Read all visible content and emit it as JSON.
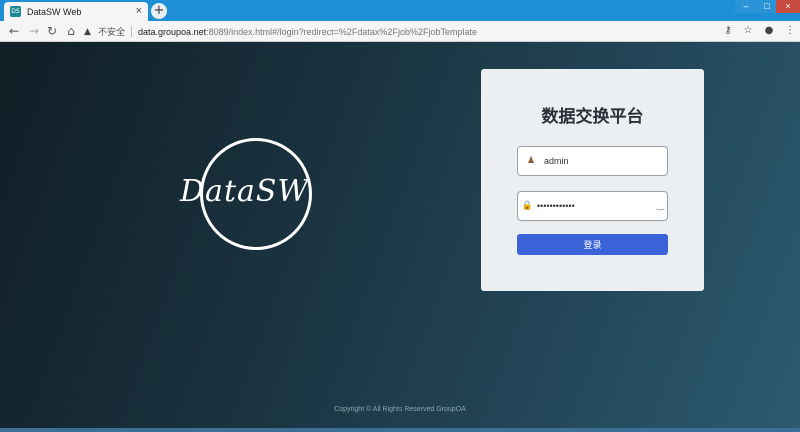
{
  "browser": {
    "tab_title": "DataSW Web",
    "favicon_text": "DS",
    "tab_close": "×",
    "new_tab": "+",
    "window_controls": {
      "minimize": "–",
      "maximize": "□",
      "close": "×"
    },
    "nav": {
      "back": "←",
      "forward": "→",
      "reload": "↻",
      "home": "⌂"
    },
    "security_warning_icon": "▲",
    "insecure_label": "不安全",
    "url_host": "data.groupoa.net",
    "url_path": ":8089/index.html#/login?redirect=%2Fdatax%2Fjob%2FjobTemplate",
    "toolbar_icons": {
      "key": "⚷",
      "star": "☆",
      "profile": "●",
      "menu": "⋮"
    }
  },
  "login": {
    "brand_logo_text": "DataSW",
    "title": "数据交换平台",
    "username_icon": "♟",
    "username_value": "admin",
    "password_icon": "🔒",
    "password_value": "••••••••••••",
    "eye_icon": "‿",
    "submit_label": "登录"
  },
  "footer": {
    "copyright": "Copyright © All Rights Reserved GroupOA"
  },
  "colors": {
    "accent": "#3a63d8",
    "titlebar": "#1e8fd4",
    "card_bg": "#eceff1"
  }
}
